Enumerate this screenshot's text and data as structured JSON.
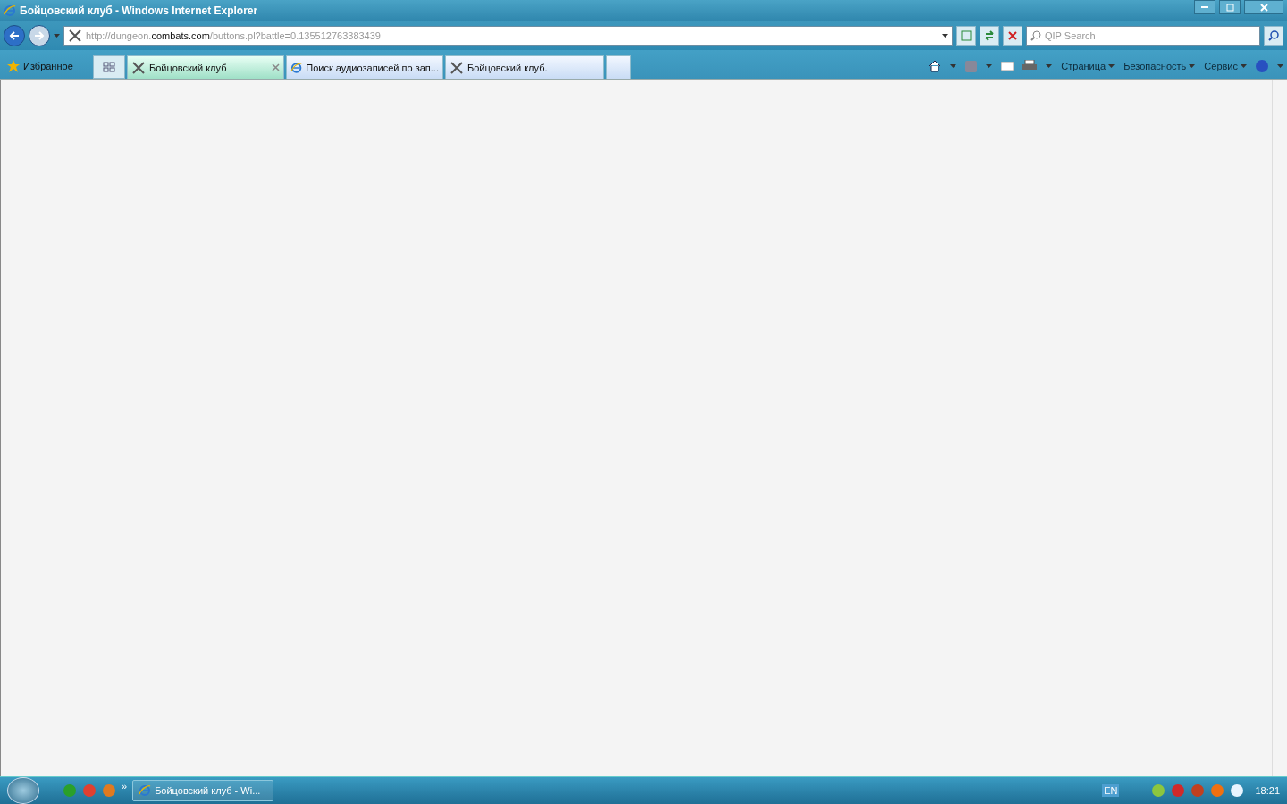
{
  "window": {
    "title": "Бойцовский клуб - Windows Internet Explorer"
  },
  "address": {
    "url_prefix": "http://dungeon.",
    "url_host": "combats.com",
    "url_path": "/buttons.pl?battle=0.135512763383439"
  },
  "search": {
    "placeholder": "QIP Search"
  },
  "favorites": {
    "label": "Избранное"
  },
  "tabs": [
    {
      "title": "Бойцовский клуб",
      "selected": true,
      "kind": "swords"
    },
    {
      "title": "Поиск аудиозаписей по зап...",
      "selected": false,
      "kind": "ie"
    },
    {
      "title": "Бойцовский клуб.",
      "selected": false,
      "kind": "swords"
    }
  ],
  "command_menus": [
    "Страница",
    "Безопасность",
    "Сервис"
  ],
  "taskbar": {
    "more": "»",
    "task": "Бойцовский клуб - Wi...",
    "language": "EN",
    "clock": "18:21"
  }
}
